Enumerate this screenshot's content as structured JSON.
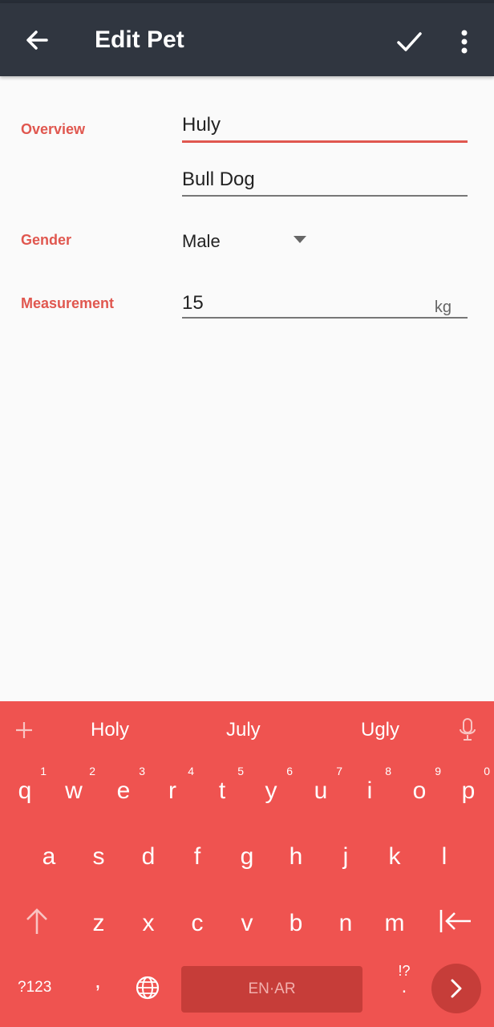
{
  "header": {
    "title": "Edit Pet"
  },
  "form": {
    "overview_label": "Overview",
    "name_value": "Huly",
    "breed_value": "Bull Dog",
    "gender_label": "Gender",
    "gender_value": "Male",
    "measurement_label": "Measurement",
    "measurement_value": "15",
    "measurement_unit": "kg"
  },
  "keyboard": {
    "suggestions": [
      "Holy",
      "July",
      "Ugly"
    ],
    "row1": [
      "q",
      "w",
      "e",
      "r",
      "t",
      "y",
      "u",
      "i",
      "o",
      "p"
    ],
    "row1_hints": [
      "1",
      "2",
      "3",
      "4",
      "5",
      "6",
      "7",
      "8",
      "9",
      "0"
    ],
    "row2": [
      "a",
      "s",
      "d",
      "f",
      "g",
      "h",
      "j",
      "k",
      "l"
    ],
    "row3": [
      "z",
      "x",
      "c",
      "v",
      "b",
      "n",
      "m"
    ],
    "symbols_label": "?123",
    "comma_label": ",",
    "space_label": "EN·AR",
    "punct_label": ".",
    "punct_hint": "!?"
  },
  "colors": {
    "accent": "#e0574f",
    "appbar": "#303640",
    "keyboard": "#ef5350"
  }
}
